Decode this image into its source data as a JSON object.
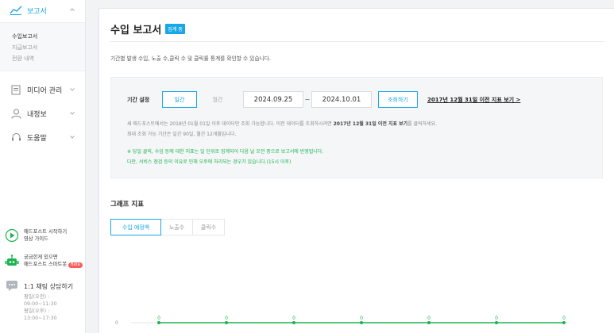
{
  "sidebar": {
    "report": {
      "label": "보고서"
    },
    "report_sub": [
      "수입보고서",
      "지급보고서",
      "전환 내역"
    ],
    "media": {
      "label": "미디어 관리"
    },
    "myinfo": {
      "label": "내정보"
    },
    "help": {
      "label": "도움말"
    },
    "guide": {
      "line1": "애드포스트 시작하기",
      "line2": "영상 가이드"
    },
    "chatbot": {
      "line1": "궁금한게 있으면",
      "line2": "애드포스트 스마트봇",
      "badge": "Beta"
    },
    "chat": {
      "title": "1:1 채팅 상담하기",
      "hours": [
        "평일(오전) :",
        "09:00~11:30",
        "평일(오후) :",
        "13:00~17:30"
      ]
    }
  },
  "main": {
    "title": "수입 보고서",
    "tag": "집계 중",
    "description": "기간별 발생 수입, 노출 수,클릭 수 및 클릭률 통계를 확인할 수 있습니다.",
    "filter": {
      "label": "기간 설정",
      "tab_daily": "일간",
      "tab_monthly": "월간",
      "start_date": "2024.09.25",
      "separator": "~",
      "end_date": "2024.10.01",
      "query_button": "조회하기",
      "old_link": "2017년 12월 31일 이전 지표 보기 >",
      "notice1_pre": "새 애드포스트에서는 2018년 01월 01일 이후 데이터만 조회 가능합니다. 이전 데이터를 조회하시려면",
      "notice1_bold": "2017년 12월 31일 이전 지표 보기",
      "notice1_post": "를 클릭하세요.",
      "notice2": "최대 조회 가능 기간은 일간 90일, 월간 12개월입니다.",
      "green1": "※ 당일 클릭, 수입 등에 대한 지표는 일 단위로 집계되어 다음 날 오전 중으로 보고서에 반영됩니다.",
      "green2": "다만, 서비스 점검 등의 이유로 인해 오후에 처리되는 경우가 있습니다.(15시 이후)"
    },
    "graph": {
      "title": "그래프 지표",
      "tabs": [
        "수입 예정액",
        "노출수",
        "클릭수"
      ]
    }
  },
  "colors": {
    "accent": "#1aa7e8",
    "green": "#1bb34f"
  },
  "chart_data": {
    "type": "line",
    "y_tick": "0",
    "series": [
      {
        "values": [
          0,
          0,
          0,
          0,
          0,
          0,
          0
        ]
      }
    ]
  }
}
